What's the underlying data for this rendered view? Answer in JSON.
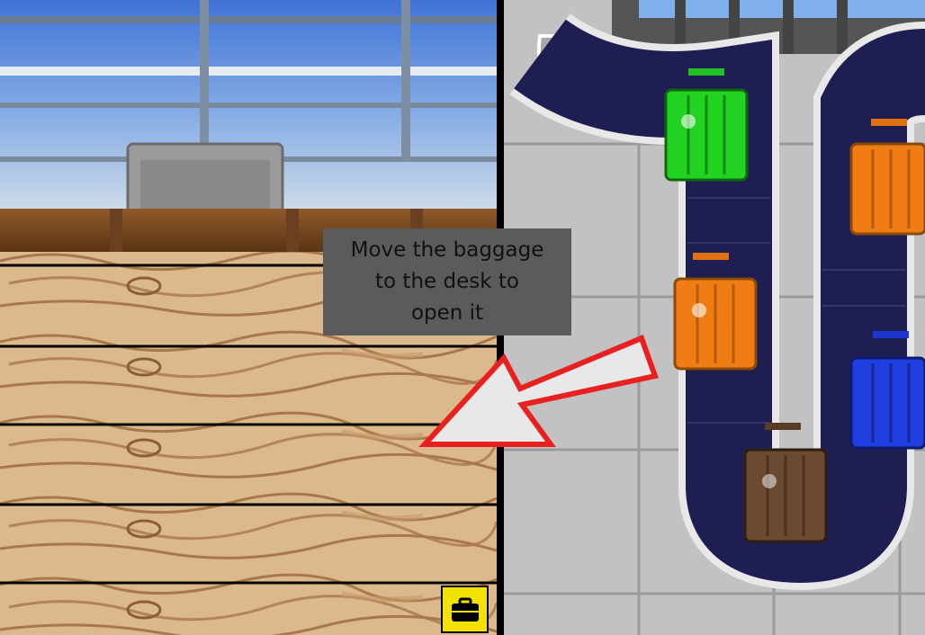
{
  "hint": {
    "line1": "Move the baggage",
    "line2": "to the desk to",
    "line3": "open it"
  },
  "icons": {
    "inventory_button": "suitcase-icon",
    "hint_arrow": "arrow-pointer-icon"
  },
  "conveyor": {
    "suitcases": [
      {
        "name": "green-suitcase",
        "color": "#22d322"
      },
      {
        "name": "orange-suitcase",
        "color": "#f07d14"
      },
      {
        "name": "orange-suitcase",
        "color": "#f07d14"
      },
      {
        "name": "blue-suitcase",
        "color": "#1f3fe0"
      },
      {
        "name": "brown-suitcase",
        "color": "#6b4a32"
      }
    ]
  },
  "colors": {
    "sky": "#4f86d9",
    "counter": "#7a4a22",
    "wood": "#d9b588",
    "belt": "#1e1e52",
    "button": "#f3e100",
    "arrow": "#e82020",
    "hint_bg": "#5b5b5b"
  }
}
